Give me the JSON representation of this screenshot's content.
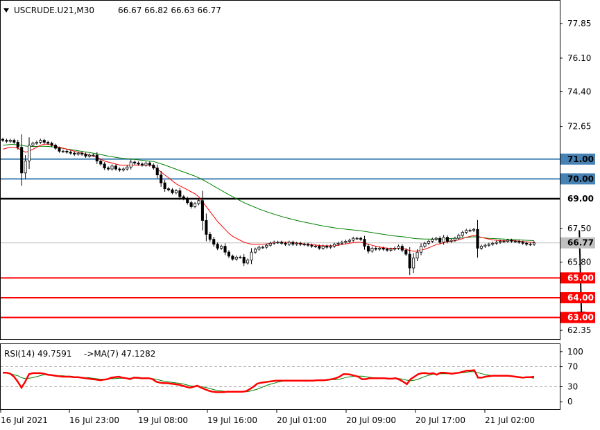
{
  "header": {
    "symbol": "USCRUDE.U21,M30",
    "ohlc": "66.67 66.82 66.63 66.77"
  },
  "rsi_header": {
    "label": "RSI(14) 49.7591",
    "ma_label": "->MA(7) 47.1282"
  },
  "colors": {
    "resistance": "#4682b4",
    "support": "#ff0000",
    "key_level": "#000000",
    "ma_fast": "#ff0000",
    "ma_slow": "#008000",
    "rsi": "#ff0000",
    "rsi_ma": "#008000",
    "current_price_line": "#c0c0c0",
    "arrow": "#000000"
  },
  "chart_data": [
    {
      "type": "candlestick",
      "title": "USCRUDE.U21,M30",
      "ylim": [
        61.9,
        79.0
      ],
      "y_ticks": [
        "77.85",
        "76.10",
        "74.40",
        "72.65",
        "67.50",
        "65.80",
        "62.35"
      ],
      "x_ticks": [
        "16 Jul 2021",
        "16 Jul 23:00",
        "19 Jul 08:00",
        "19 Jul 16:00",
        "20 Jul 01:00",
        "20 Jul 09:00",
        "20 Jul 17:00",
        "21 Jul 02:00"
      ],
      "current_price": 66.77,
      "current_price_label": "66.77",
      "levels": [
        {
          "value": 71.0,
          "label": "71.00",
          "kind": "resistance"
        },
        {
          "value": 70.0,
          "label": "70.00",
          "kind": "resistance"
        },
        {
          "value": 69.0,
          "label": "69.00",
          "kind": "key_level"
        },
        {
          "value": 65.0,
          "label": "65.00",
          "kind": "support"
        },
        {
          "value": 64.0,
          "label": "64.00",
          "kind": "support"
        },
        {
          "value": 63.0,
          "label": "63.00",
          "kind": "support"
        }
      ],
      "forecast_arrow": {
        "from_index": 153,
        "from_value": 67.4,
        "to_value": 62.95
      },
      "close": [
        71.95,
        71.9,
        71.95,
        71.85,
        71.6,
        70.3,
        70.9,
        71.7,
        71.8,
        71.85,
        71.95,
        71.85,
        71.8,
        71.7,
        71.55,
        71.4,
        71.4,
        71.35,
        71.3,
        71.25,
        71.3,
        71.25,
        71.15,
        71.2,
        71.2,
        70.9,
        70.75,
        70.55,
        70.5,
        70.65,
        70.5,
        70.45,
        70.5,
        70.6,
        70.85,
        70.8,
        70.75,
        70.7,
        70.8,
        70.7,
        70.55,
        70.2,
        69.8,
        69.5,
        69.45,
        69.3,
        69.4,
        69.1,
        69.0,
        68.8,
        68.6,
        68.75,
        68.9,
        67.9,
        67.2,
        66.95,
        66.7,
        66.5,
        66.6,
        66.3,
        66.1,
        65.95,
        66.05,
        66.05,
        65.75,
        65.9,
        66.3,
        66.45,
        66.55,
        66.55,
        66.65,
        66.75,
        66.8,
        66.8,
        66.75,
        66.7,
        66.8,
        66.7,
        66.75,
        66.7,
        66.7,
        66.65,
        66.6,
        66.6,
        66.5,
        66.6,
        66.55,
        66.6,
        66.7,
        66.75,
        66.8,
        66.85,
        66.9,
        67.0,
        67.0,
        66.95,
        66.6,
        66.35,
        66.5,
        66.45,
        66.5,
        66.45,
        66.4,
        66.45,
        66.5,
        66.6,
        66.4,
        66.2,
        65.5,
        66.0,
        66.3,
        66.6,
        66.75,
        66.85,
        66.95,
        67.0,
        66.8,
        67.05,
        66.85,
        66.9,
        67.0,
        67.15,
        67.3,
        67.4,
        67.4,
        67.45,
        66.5,
        66.6,
        66.65,
        66.7,
        66.75,
        66.8,
        66.85,
        66.85,
        66.9,
        66.85,
        66.85,
        66.8,
        66.75,
        66.7,
        66.7,
        66.77
      ],
      "ma_fast": [
        71.5,
        71.55,
        71.6,
        71.6,
        71.55,
        71.45,
        71.35,
        71.4,
        71.5,
        71.6,
        71.7,
        71.75,
        71.75,
        71.7,
        71.65,
        71.6,
        71.55,
        71.5,
        71.45,
        71.4,
        71.35,
        71.3,
        71.25,
        71.2,
        71.15,
        71.1,
        71.0,
        70.9,
        70.85,
        70.8,
        70.75,
        70.7,
        70.7,
        70.7,
        70.7,
        70.7,
        70.7,
        70.7,
        70.7,
        70.7,
        70.65,
        70.5,
        70.35,
        70.2,
        70.05,
        69.9,
        69.75,
        69.65,
        69.55,
        69.45,
        69.35,
        69.25,
        69.1,
        68.85,
        68.6,
        68.35,
        68.1,
        67.85,
        67.65,
        67.45,
        67.25,
        67.1,
        67.0,
        66.9,
        66.8,
        66.75,
        66.7,
        66.7,
        66.7,
        66.7,
        66.72,
        66.75,
        66.78,
        66.8,
        66.8,
        66.8,
        66.8,
        66.78,
        66.76,
        66.74,
        66.72,
        66.7,
        66.68,
        66.66,
        66.64,
        66.62,
        66.62,
        66.62,
        66.63,
        66.65,
        66.68,
        66.72,
        66.75,
        66.78,
        66.8,
        66.8,
        66.76,
        66.7,
        66.65,
        66.6,
        66.56,
        66.53,
        66.5,
        66.5,
        66.5,
        66.5,
        66.48,
        66.45,
        66.38,
        66.35,
        66.36,
        66.4,
        66.45,
        66.52,
        66.6,
        66.68,
        66.72,
        66.78,
        66.82,
        66.85,
        66.88,
        66.92,
        66.98,
        67.05,
        67.1,
        67.15,
        67.1,
        67.05,
        67.0,
        66.96,
        66.92,
        66.9,
        66.88,
        66.88,
        66.88,
        66.88,
        66.88,
        66.86,
        66.84,
        66.82,
        66.8,
        66.8
      ],
      "ma_slow": [
        71.7,
        71.72,
        71.74,
        71.74,
        71.72,
        71.7,
        71.66,
        71.64,
        71.64,
        71.64,
        71.65,
        71.65,
        71.64,
        71.62,
        71.6,
        71.57,
        71.54,
        71.51,
        71.48,
        71.45,
        71.42,
        71.39,
        71.36,
        71.33,
        71.3,
        71.27,
        71.23,
        71.19,
        71.15,
        71.12,
        71.09,
        71.06,
        71.04,
        71.02,
        71.0,
        70.98,
        70.96,
        70.94,
        70.92,
        70.9,
        70.88,
        70.82,
        70.76,
        70.7,
        70.63,
        70.56,
        70.49,
        70.42,
        70.35,
        70.28,
        70.21,
        70.14,
        70.06,
        69.96,
        69.86,
        69.75,
        69.64,
        69.53,
        69.42,
        69.31,
        69.2,
        69.1,
        69.0,
        68.9,
        68.8,
        68.72,
        68.64,
        68.56,
        68.48,
        68.41,
        68.34,
        68.28,
        68.22,
        68.16,
        68.1,
        68.05,
        68.0,
        67.95,
        67.9,
        67.86,
        67.82,
        67.78,
        67.74,
        67.7,
        67.66,
        67.62,
        67.59,
        67.56,
        67.53,
        67.5,
        67.48,
        67.46,
        67.44,
        67.42,
        67.4,
        67.38,
        67.35,
        67.32,
        67.29,
        67.26,
        67.23,
        67.2,
        67.17,
        67.14,
        67.12,
        67.1,
        67.08,
        67.06,
        67.03,
        67.0,
        66.98,
        66.97,
        66.96,
        66.96,
        66.96,
        66.96,
        66.96,
        66.97,
        66.98,
        66.99,
        67.0,
        67.01,
        67.02,
        67.04,
        67.06,
        67.08,
        67.06,
        67.04,
        67.02,
        67.0,
        66.99,
        66.98,
        66.97,
        66.96,
        66.95,
        66.94,
        66.93,
        66.92,
        66.91,
        66.9,
        66.89,
        66.88
      ]
    },
    {
      "type": "line",
      "title": "RSI(14)",
      "ylim": [
        -15,
        115
      ],
      "y_ticks": [
        "100",
        "70",
        "30",
        "0"
      ],
      "levels": [
        70,
        30
      ],
      "rsi": [
        58,
        58,
        56,
        50,
        40,
        28,
        40,
        55,
        57,
        57,
        57,
        56,
        54,
        53,
        52,
        51,
        50,
        50,
        50,
        49,
        49,
        48,
        47,
        46,
        45,
        44,
        43,
        44,
        45,
        48,
        49,
        50,
        48,
        47,
        45,
        48,
        48,
        47,
        47,
        47,
        45,
        40,
        38,
        37,
        37,
        36,
        35,
        34,
        32,
        30,
        28,
        30,
        32,
        28,
        25,
        22,
        20,
        19,
        19,
        19,
        20,
        20,
        20,
        20,
        20,
        21,
        25,
        30,
        36,
        38,
        39,
        40,
        41,
        42,
        42,
        42,
        42,
        42,
        42,
        42,
        42,
        42,
        42,
        42,
        43,
        43,
        43,
        44,
        45,
        47,
        50,
        55,
        55,
        54,
        52,
        50,
        45,
        45,
        47,
        47,
        47,
        47,
        47,
        46,
        46,
        47,
        44,
        40,
        35,
        45,
        50,
        55,
        57,
        57,
        56,
        57,
        54,
        58,
        58,
        57,
        56,
        57,
        58,
        60,
        62,
        62,
        63,
        48,
        48,
        50,
        51,
        52,
        52,
        52,
        52,
        52,
        51,
        50,
        49,
        48,
        49,
        49,
        50
      ],
      "rsi_ma": [
        57,
        57,
        56,
        54,
        52,
        48,
        46,
        47,
        48,
        50,
        52,
        54,
        54,
        54,
        53,
        52,
        52,
        51,
        51,
        50,
        50,
        49,
        48,
        48,
        47,
        46,
        45,
        45,
        45,
        46,
        46,
        47,
        47,
        47,
        47,
        47,
        47,
        47,
        47,
        47,
        46,
        45,
        43,
        41,
        40,
        39,
        38,
        37,
        36,
        34,
        32,
        31,
        31,
        30,
        29,
        27,
        25,
        23,
        22,
        21,
        20,
        20,
        20,
        20,
        20,
        20,
        21,
        23,
        25,
        28,
        31,
        34,
        36,
        38,
        40,
        41,
        41,
        42,
        42,
        42,
        42,
        42,
        42,
        42,
        42,
        43,
        43,
        43,
        44,
        44,
        45,
        47,
        49,
        50,
        51,
        51,
        51,
        50,
        49,
        48,
        48,
        47,
        47,
        47,
        47,
        47,
        46,
        45,
        43,
        42,
        43,
        45,
        48,
        51,
        53,
        55,
        55,
        56,
        56,
        56,
        56,
        57,
        57,
        58,
        59,
        60,
        60,
        58,
        56,
        54,
        53,
        52,
        51,
        51,
        51,
        51,
        51,
        50,
        50,
        49,
        49,
        48,
        47
      ]
    }
  ]
}
